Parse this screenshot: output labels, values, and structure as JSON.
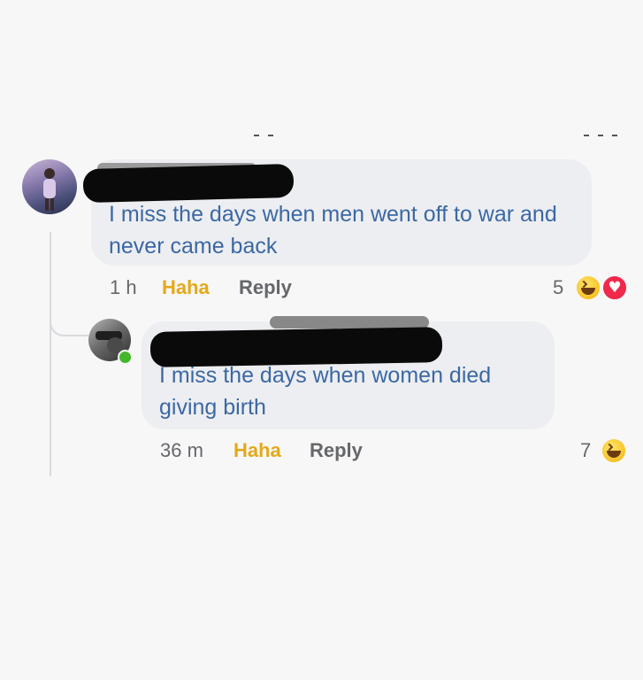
{
  "comments": [
    {
      "text": "I miss the days when men went off to war and never came back",
      "time": "1 h",
      "haha_label": "Haha",
      "reply_label": "Reply",
      "reaction_count": "5",
      "reactions": [
        "haha-icon",
        "love-icon"
      ]
    },
    {
      "text": "I miss the days when women died giving birth",
      "time": "36 m",
      "haha_label": "Haha",
      "reply_label": "Reply",
      "reaction_count": "7",
      "reactions": [
        "haha-icon"
      ]
    }
  ],
  "colors": {
    "comment_text": "#3b68a3",
    "haha_reaction": "#e3a919",
    "meta_text": "#65676b",
    "bubble": "#edeef1",
    "love_reaction": "#f0284a",
    "online_status": "#42b72a"
  }
}
